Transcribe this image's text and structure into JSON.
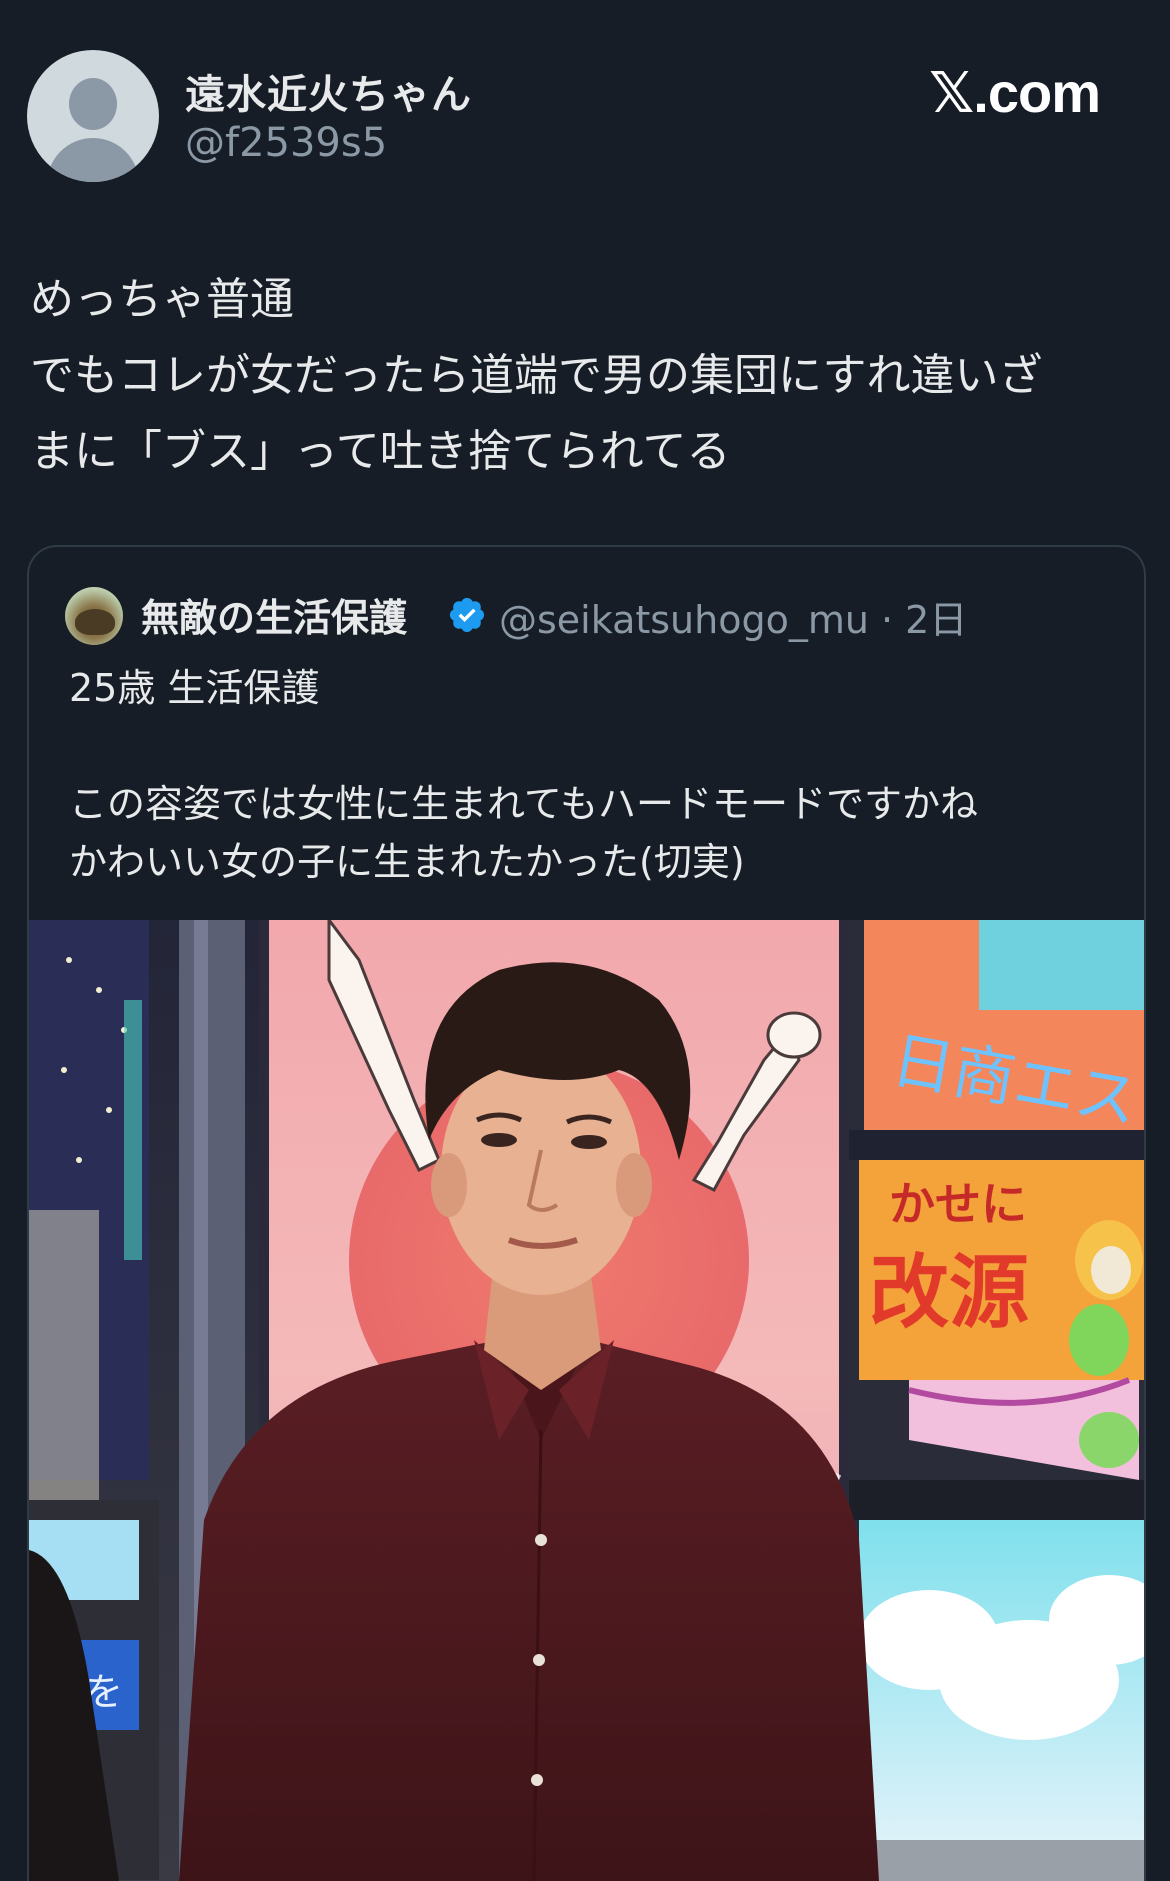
{
  "header": {
    "display_name": "遠水近火ちゃん",
    "handle": "@f2539s5",
    "brand": "X.com",
    "brand_x": "𝕏",
    "brand_rest": ".com"
  },
  "tweet": {
    "lines": [
      "めっちゃ普通",
      "でもコレが女だったら道端で男の集団にすれ違いざ",
      "まに「ブス」って吐き捨てられてる"
    ]
  },
  "quote": {
    "display_name": "無敵の生活保護",
    "verified_icon": "verified-badge-icon",
    "handle_time": "@seikatsuhogo_mu · 2日",
    "lines": [
      "25歳 生活保護",
      "",
      "この容姿では女性に生まれてもハードモードですかね",
      "かわいい女の子に生まれたかった(切実)"
    ],
    "photo": {
      "sign_top": "日商エス",
      "sign_small": "かせに",
      "sign_big": "改源",
      "sign_left": "力を"
    }
  },
  "colors": {
    "background": "#161d26",
    "text_primary": "#e7e9ea",
    "text_secondary": "#8b98a5",
    "border": "#2f3b47",
    "verified": "#1d9bf0"
  }
}
